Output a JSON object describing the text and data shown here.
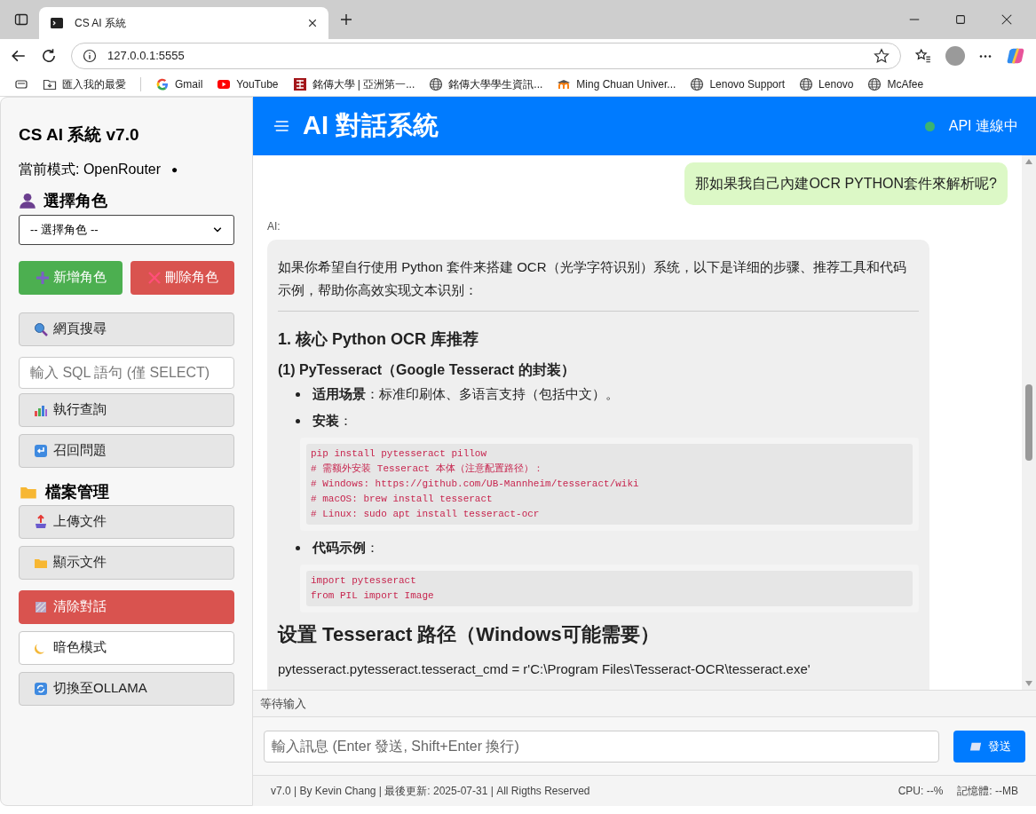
{
  "browser": {
    "tabs": [
      {
        "title": "CS AI 系統",
        "selected": true
      }
    ],
    "address": "127.0.0.1:5555",
    "bookmarks": [
      {
        "label": "匯入我的最愛",
        "kind": "import"
      },
      {
        "label": "Gmail",
        "kind": "g"
      },
      {
        "label": "YouTube",
        "kind": "yt"
      },
      {
        "label": "銘傳大學 | 亞洲第一...",
        "kind": "mcu"
      },
      {
        "label": "銘傳大學學生資訊...",
        "kind": "globe"
      },
      {
        "label": "Ming Chuan Univer...",
        "kind": "moodle"
      },
      {
        "label": "Lenovo Support",
        "kind": "globe"
      },
      {
        "label": "Lenovo",
        "kind": "globe"
      },
      {
        "label": "McAfee",
        "kind": "globe"
      }
    ]
  },
  "sidebar": {
    "title": "CS AI 系統 v7.0",
    "mode": "當前模式: OpenRouter",
    "mode_dot": "●",
    "role_heading": "選擇角色",
    "role_select": "-- 選擇角色 --",
    "role_buttons": [
      {
        "label": "新增角色",
        "kind": "add"
      },
      {
        "label": "刪除角色",
        "kind": "delete"
      }
    ],
    "search_button": "網頁搜尋",
    "sql_placeholder": "輸入 SQL 語句 (僅 SELECT)",
    "query_buttons": [
      {
        "label": "執行查詢",
        "kind": "chart"
      },
      {
        "label": "召回問題",
        "kind": "recall"
      }
    ],
    "files_heading": "檔案管理",
    "file_buttons": [
      {
        "label": "上傳文件",
        "kind": "upload"
      },
      {
        "label": "顯示文件",
        "kind": "folder"
      }
    ],
    "bottom_buttons": [
      {
        "label": "清除對話",
        "kind": "danger"
      },
      {
        "label": "暗色模式",
        "kind": "light"
      },
      {
        "label": "切換至OLLAMA",
        "kind": "plain"
      }
    ]
  },
  "header": {
    "title": "AI 對話系統",
    "api_status": "API 連線中",
    "connected": true
  },
  "messages": [
    {
      "kind": "user",
      "text": "那如果我自己內建OCR PYTHON套件來解析呢?"
    },
    {
      "kind": "ai",
      "label": "AI:",
      "blocks": [
        {
          "kind": "p",
          "text": "如果你希望自行使用 Python 套件来搭建 OCR（光学字符识别）系统，以下是详细的步骤、推荐工具和代码示例，帮助你高效实现文本识别："
        },
        {
          "kind": "hr"
        },
        {
          "kind": "h3",
          "text": "1. 核心 Python OCR 库推荐"
        },
        {
          "kind": "h4",
          "text": "(1) PyTesseract（Google Tesseract 的封装）"
        },
        {
          "kind": "li",
          "text": "**适用场景**：标准印刷体、多语言支持（包括中文）。"
        },
        {
          "kind": "li",
          "text": "**安装**："
        },
        {
          "kind": "code",
          "lines": [
            "pip install pytesseract pillow",
            "# 需额外安装 Tesseract 本体（注意配置路径）：",
            "# Windows: https://github.com/UB-Mannheim/tesseract/wiki",
            "# macOS: brew install tesseract",
            "# Linux: sudo apt install tesseract-ocr"
          ]
        },
        {
          "kind": "li",
          "text": "**代码示例**："
        },
        {
          "kind": "code",
          "lines": [
            "import pytesseract",
            "from PIL import Image"
          ]
        },
        {
          "kind": "h2",
          "text": "设置 Tesseract 路径（Windows可能需要）"
        },
        {
          "kind": "p",
          "text": "pytesseract.pytesseract.tesseract_cmd = r'C:\\Program Files\\Tesseract-OCR\\tesseract.exe'"
        }
      ]
    }
  ],
  "status": "等待输入",
  "input_placeholder": "輸入訊息 (Enter 發送, Shift+Enter 換行)",
  "send_button": "發送",
  "footer": {
    "credits": "v7.0 | By Kevin Chang | 最後更新: 2025-07-31 | All Rigths Reserved",
    "cpu": "CPU: --%",
    "memory": "記憶體: --MB"
  }
}
